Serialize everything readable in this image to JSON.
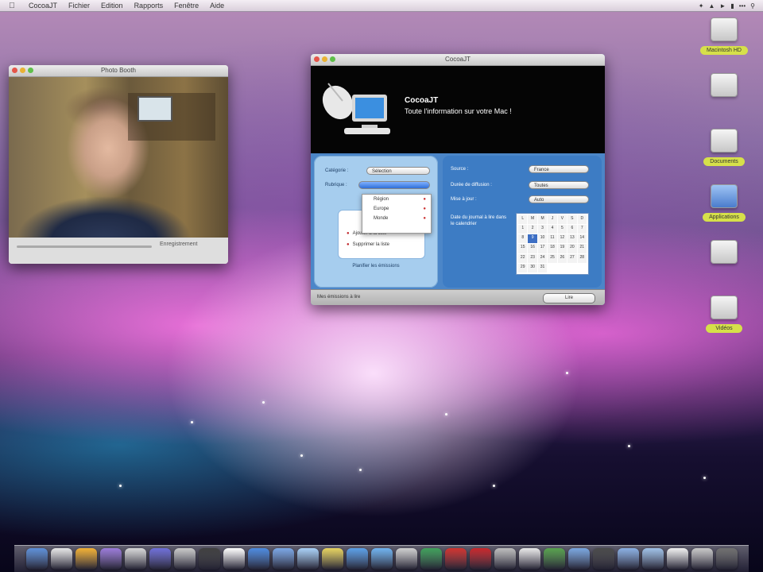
{
  "menubar": {
    "apple": "",
    "items": [
      "CocoaJT",
      "Fichier",
      "Edition",
      "Rapports",
      "Fenêtre",
      "Aide"
    ],
    "status": [
      "",
      "",
      ""
    ]
  },
  "video_window": {
    "title": "Photo Booth",
    "status": "Enregistrement"
  },
  "app_window": {
    "title": "CocoaJT",
    "app_name": "CocoaJT",
    "tagline": "Toute l'information sur votre Mac !",
    "left": {
      "field1_label": "Catégorie :",
      "field1_value": "Sélection",
      "field2_label": "Rubrique :",
      "field2_value": "",
      "dropdown": [
        "Région",
        "Europe",
        "Monde"
      ],
      "option1": "Ajouter à la liste",
      "option2": "Supprimer la liste",
      "footer": "Planifier les émissions"
    },
    "right": {
      "label1": "Source :",
      "value1": "France",
      "label2": "Durée de diffusion :",
      "value2": "Toutes",
      "label3": "Mise à jour :",
      "value3": "Auto",
      "note": "Date du journal à lire dans le calendrier",
      "calendar": [
        "L",
        "M",
        "M",
        "J",
        "V",
        "S",
        "D",
        "1",
        "2",
        "3",
        "4",
        "5",
        "6",
        "7",
        "8",
        "9",
        "10",
        "11",
        "12",
        "13",
        "14",
        "15",
        "16",
        "17",
        "18",
        "19",
        "20",
        "21",
        "22",
        "23",
        "24",
        "25",
        "26",
        "27",
        "28",
        "29",
        "30",
        "31"
      ],
      "today_index": 15
    },
    "bottom": {
      "left": "Mes émissions à lire",
      "button": "Lire"
    }
  },
  "desktop": {
    "icons": [
      {
        "label": "Macintosh HD",
        "style": "yellow"
      },
      {
        "label": "",
        "style": "plain"
      },
      {
        "label": "Documents",
        "style": "yellow"
      },
      {
        "label": "Applications",
        "style": "yellow"
      },
      {
        "label": "",
        "style": "plain"
      },
      {
        "label": "Vidéos",
        "style": "yellow"
      }
    ]
  },
  "dock": {
    "icons": [
      "#5d8fd8",
      "#e7e7e7",
      "#f2b134",
      "#9a7ad9",
      "#d8d8d8",
      "#6e6ed8",
      "#c9c9c9",
      "#404040",
      "#ffffff",
      "#4c8ae0",
      "#7aa7e6",
      "#a8d0f7",
      "#e7d35f",
      "#5a9fe8",
      "#6fb3f0",
      "#cfcfcf",
      "#3fa05b",
      "#d0332f",
      "#c8272c",
      "#bdbdbd",
      "#e9e9e9",
      "#57a24d",
      "#79a6e0",
      "#4a4a4a",
      "#8ab0e4",
      "#9fc1e8",
      "#f0f0f0",
      "#c8c8c8",
      "#707070"
    ]
  }
}
